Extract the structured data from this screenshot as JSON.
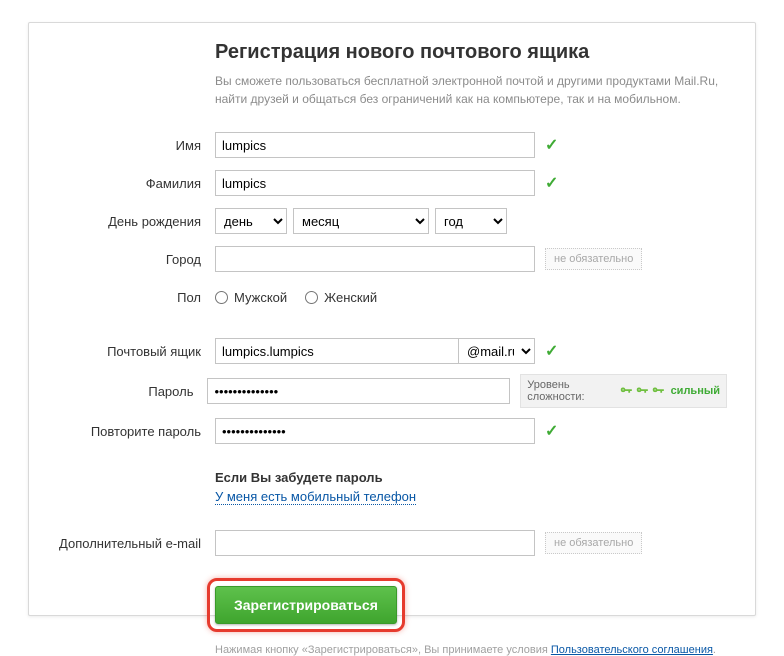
{
  "title": "Регистрация нового почтового ящика",
  "subtitle": "Вы сможете пользоваться бесплатной электронной почтой и другими продуктами Mail.Ru, найти друзей и общаться без ограничений как на компьютере, так и на мобильном.",
  "labels": {
    "firstname": "Имя",
    "lastname": "Фамилия",
    "birthday": "День рождения",
    "city": "Город",
    "gender": "Пол",
    "mailbox": "Почтовый ящик",
    "password": "Пароль",
    "password_repeat": "Повторите пароль",
    "additional_email": "Дополнительный e-mail"
  },
  "values": {
    "firstname": "lumpics",
    "lastname": "lumpics",
    "city": "",
    "mailbox": "lumpics.lumpics",
    "password": "••••••••••••••",
    "password_repeat": "••••••••••••••",
    "additional_email": ""
  },
  "selects": {
    "day": "день",
    "month": "месяц",
    "year": "год",
    "domain": "@mail.ru"
  },
  "gender": {
    "male": "Мужской",
    "female": "Женский"
  },
  "optional": "не обязательно",
  "strength": {
    "label": "Уровень сложности:",
    "value": "сильный"
  },
  "forgot": {
    "title": "Если Вы забудете пароль",
    "link": "У меня есть мобильный телефон"
  },
  "submit": "Зарегистрироваться",
  "terms": {
    "prefix": "Нажимая кнопку «Зарегистрироваться», Вы принимаете условия ",
    "link": "Пользовательского соглашения",
    "suffix": "."
  }
}
